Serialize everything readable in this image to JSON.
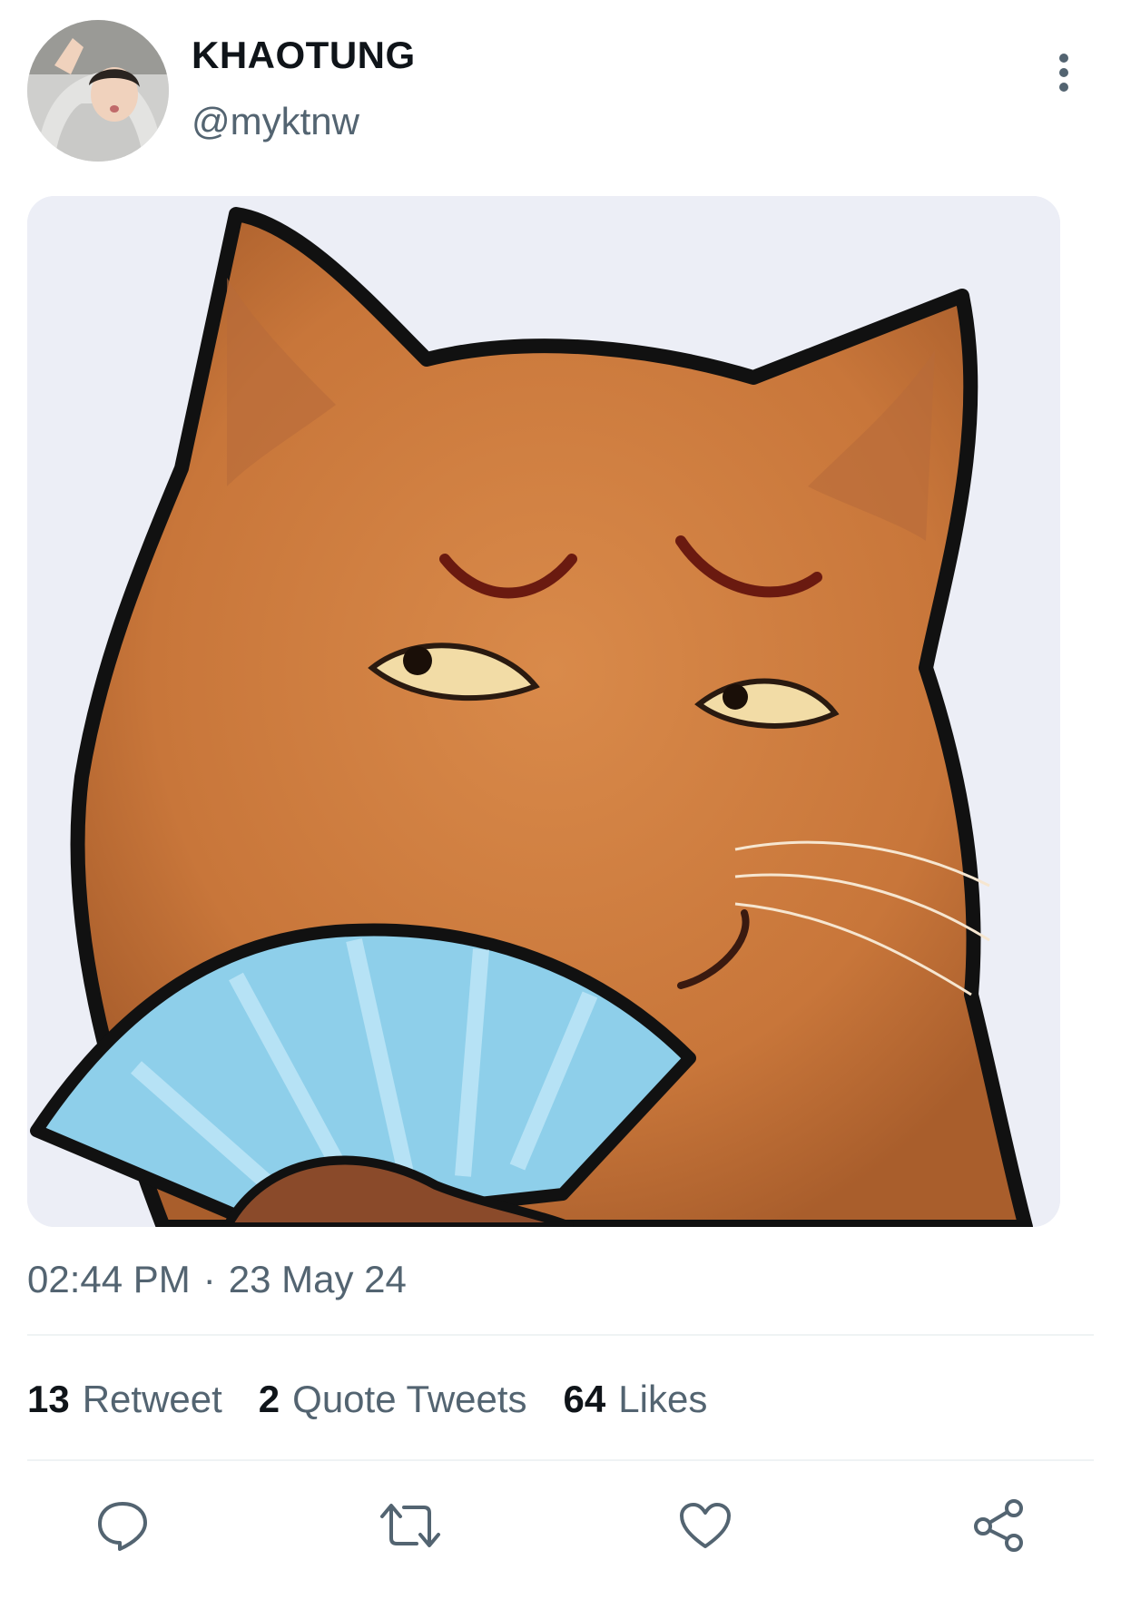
{
  "tweet": {
    "display_name": "KHAOTUNG",
    "handle": "@myktnw",
    "time": "02:44 PM",
    "separator": "·",
    "date": "23 May 24"
  },
  "stats": {
    "retweets": {
      "count": "13",
      "label": "Retweet"
    },
    "quotes": {
      "count": "2",
      "label": "Quote Tweets"
    },
    "likes": {
      "count": "64",
      "label": "Likes"
    }
  },
  "icons": {
    "more": "more-vertical-icon",
    "reply": "reply-icon",
    "retweet": "retweet-icon",
    "like": "heart-icon",
    "share": "share-icon"
  },
  "colors": {
    "text_primary": "#0f1419",
    "text_secondary": "#536471",
    "divider": "#eff3f4"
  }
}
